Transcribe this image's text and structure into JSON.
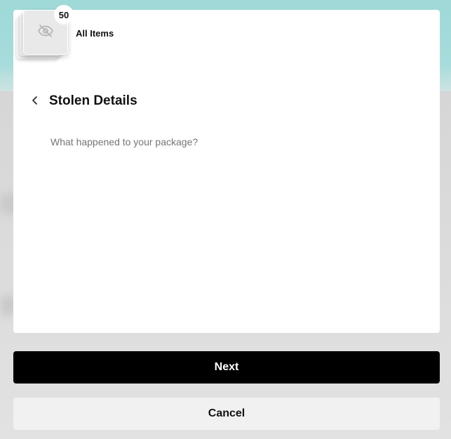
{
  "header": {
    "item_count": "50",
    "items_label": "All Items"
  },
  "page": {
    "title": "Stolen Details",
    "question_placeholder": "What happened to your package?"
  },
  "actions": {
    "next_label": "Next",
    "cancel_label": "Cancel"
  },
  "icons": {
    "thumbnail": "eye-slash-icon",
    "back": "chevron-left-icon"
  },
  "colors": {
    "background_accent": "#a6dcdb",
    "primary_button": "#000000",
    "secondary_button": "#f1f1f1"
  }
}
